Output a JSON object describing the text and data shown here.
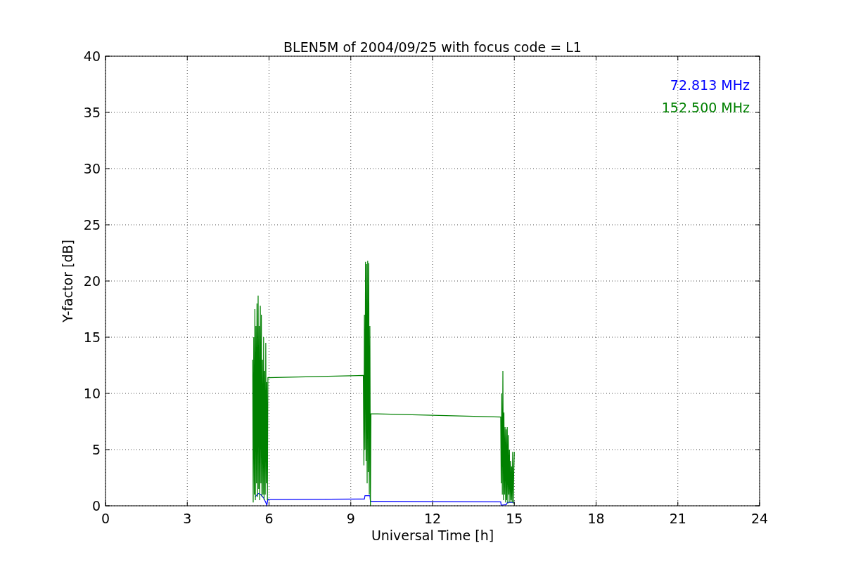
{
  "figure": {
    "chart_data": {
      "type": "line",
      "grid": true,
      "title": "BLEN5M of 2004/09/25 with focus code = L1",
      "xlabel": "Universal Time [h]",
      "ylabel": "Y-factor [dB]",
      "xlim": [
        0,
        24
      ],
      "ylim": [
        0,
        40
      ],
      "xticks": [
        0,
        3,
        6,
        9,
        12,
        15,
        18,
        21,
        24
      ],
      "yticks": [
        0,
        5,
        10,
        15,
        20,
        25,
        30,
        35,
        40
      ],
      "series": [
        {
          "name": "72.813 MHz",
          "color": "#0000ff",
          "x": [
            5.5,
            5.6,
            5.7,
            5.8,
            5.88,
            5.92,
            5.96,
            6.0,
            9.5,
            9.52,
            9.55,
            9.7,
            9.72,
            9.75,
            14.5,
            14.52,
            14.55,
            14.7,
            14.75,
            14.8,
            15.0
          ],
          "values": [
            0.8,
            1.1,
            1.0,
            0.7,
            0.3,
            0.05,
            0.6,
            0.55,
            0.6,
            0.9,
            0.9,
            0.9,
            0.4,
            0.4,
            0.35,
            0.05,
            0.05,
            0.1,
            0.3,
            0.3,
            0.3
          ]
        },
        {
          "name": "152.500 MHz",
          "color": "#008000",
          "x": [
            5.4,
            5.42,
            5.44,
            5.46,
            5.48,
            5.5,
            5.52,
            5.54,
            5.56,
            5.58,
            5.6,
            5.62,
            5.64,
            5.66,
            5.68,
            5.7,
            5.72,
            5.74,
            5.76,
            5.78,
            5.8,
            5.82,
            5.84,
            5.86,
            5.88,
            5.9,
            5.92,
            5.94,
            5.96,
            9.46,
            9.48,
            9.5,
            9.52,
            9.54,
            9.56,
            9.58,
            9.6,
            9.62,
            9.64,
            9.66,
            9.68,
            9.7,
            9.72,
            9.74,
            14.5,
            14.52,
            14.54,
            14.56,
            14.58,
            14.6,
            14.62,
            14.64,
            14.66,
            14.68,
            14.7,
            14.72,
            14.74,
            14.76,
            14.78,
            14.8,
            14.82,
            14.84,
            14.86,
            14.88,
            14.9,
            14.92,
            14.94,
            14.96,
            14.98,
            15.0
          ],
          "values": [
            13,
            0.3,
            15,
            1,
            17.5,
            0.5,
            16,
            2,
            18,
            0.8,
            18.7,
            1.5,
            16,
            0.5,
            17.8,
            2,
            17,
            0.8,
            13,
            1,
            15,
            0.5,
            12,
            1,
            14.5,
            2,
            11,
            0.5,
            11.4,
            11.6,
            3.6,
            17,
            5,
            21.7,
            4,
            21.5,
            2,
            21.8,
            3,
            21.6,
            1,
            16,
            0,
            8.2,
            7.9,
            2,
            10,
            1,
            12,
            0.5,
            8.3,
            1,
            7,
            0.3,
            6.8,
            0.5,
            7,
            0.2,
            6.3,
            1,
            5,
            0.3,
            4,
            0.5,
            3.5,
            0.3,
            4.8,
            0.2,
            3,
            4.8
          ]
        }
      ]
    }
  }
}
